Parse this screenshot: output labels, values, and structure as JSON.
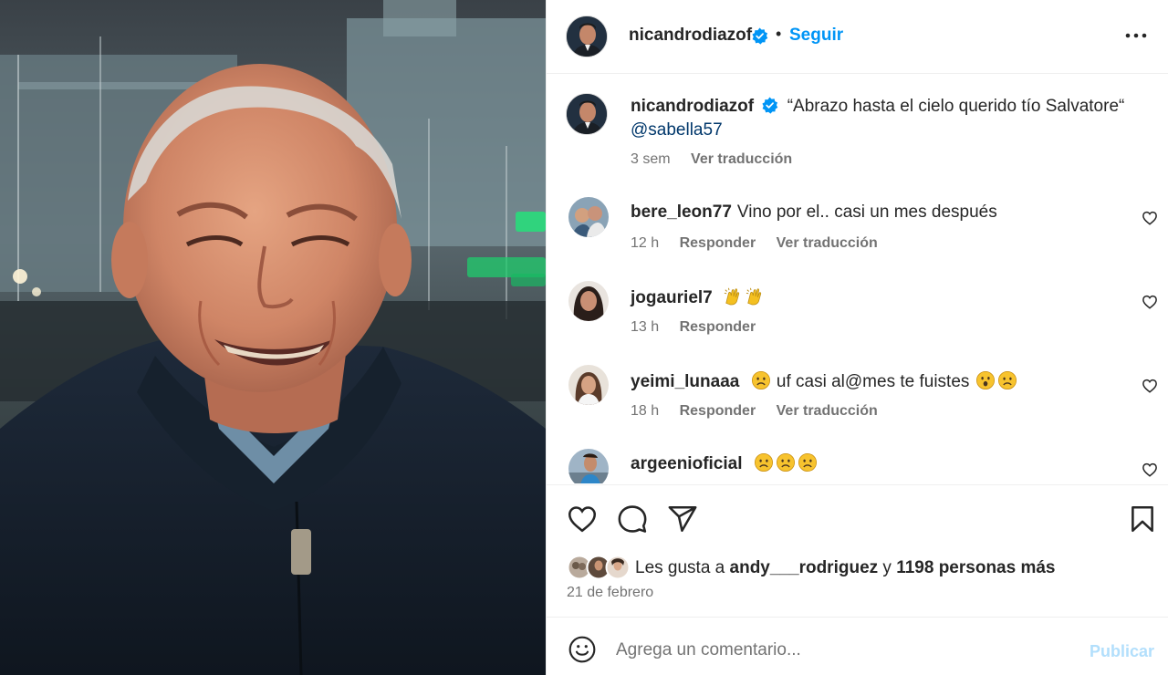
{
  "post": {
    "author": "nicandrodiazof",
    "follow_label": "Seguir",
    "dot": "•",
    "caption": "“Abrazo hasta el cielo querido tío Salvatore“",
    "mention": "@sabella57",
    "caption_time": "3 sem",
    "translate_label": "Ver traducción"
  },
  "comments": [
    {
      "user": "bere_leon77",
      "text": "Vino por el.. casi un mes después",
      "time": "12 h",
      "reply": "Responder",
      "translate": "Ver traducción"
    },
    {
      "user": "jogauriel7",
      "text": "",
      "emojis": [
        "raising-hands",
        "raising-hands"
      ],
      "time": "13 h",
      "reply": "Responder"
    },
    {
      "user": "yeimi_lunaaa",
      "text_before": "",
      "text_mid": "uf casi al@mes te fuistes",
      "emoji_before": "sad",
      "emojis_after": [
        "surprised",
        "sad"
      ],
      "time": "18 h",
      "reply": "Responder",
      "translate": "Ver traducción"
    },
    {
      "user": "argeenioficial",
      "emojis": [
        "sad",
        "sad",
        "sad"
      ]
    }
  ],
  "likes": {
    "prefix": "Les gusta a",
    "user": "andy___rodriguez",
    "joiner": "y",
    "others": "1198 personas más"
  },
  "date": "21 de febrero",
  "composer": {
    "placeholder": "Agrega un comentario...",
    "publish_label": "Publicar"
  },
  "colors": {
    "accent": "#0095f6",
    "publish_disabled": "#b2dffc",
    "verified": "#0095f6",
    "secondary_text": "#737373"
  }
}
